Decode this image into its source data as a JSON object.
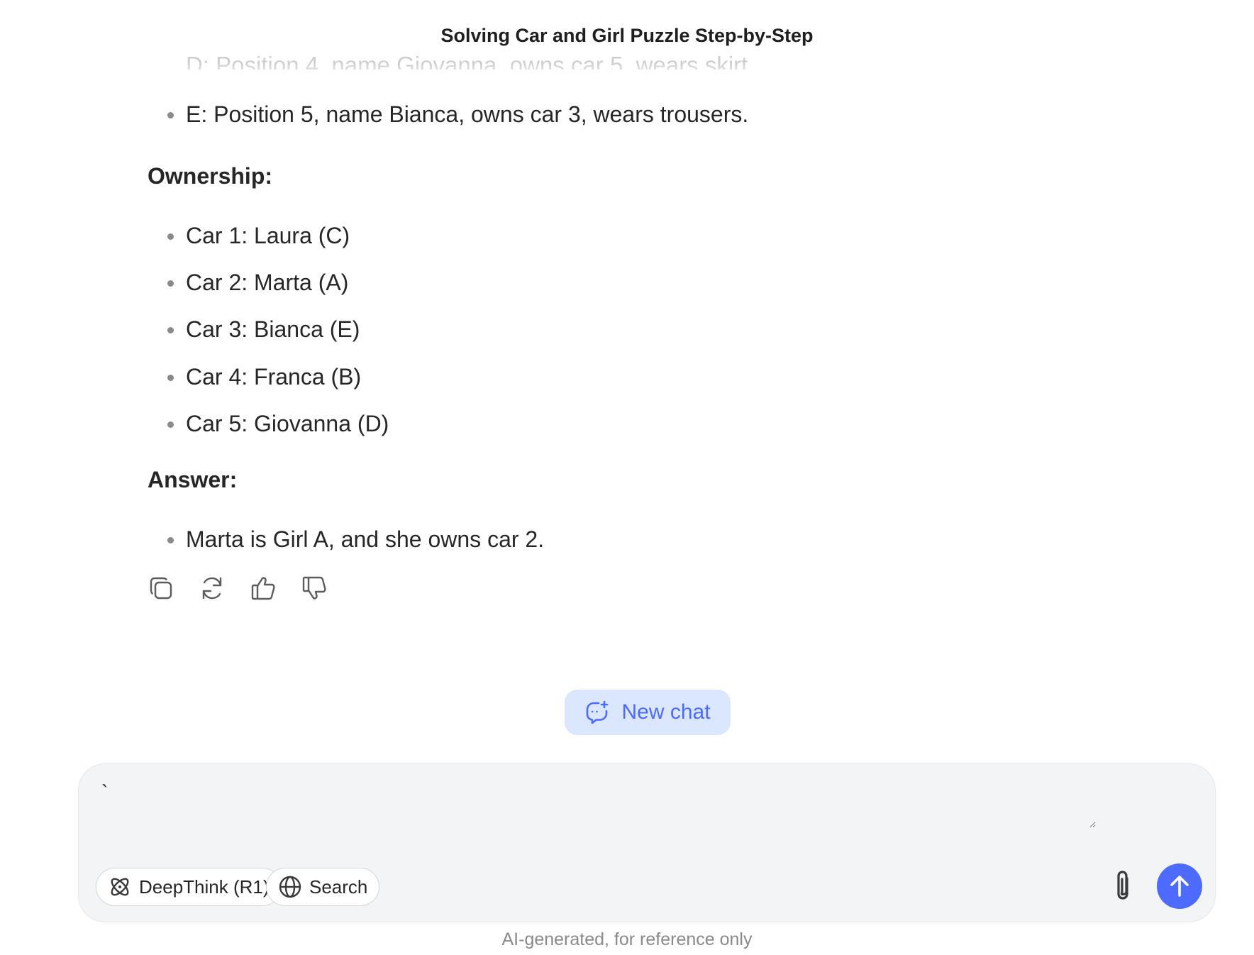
{
  "header": {
    "title": "Solving Car and Girl Puzzle Step-by-Step"
  },
  "message": {
    "faded_line": "D: Position 4, name Giovanna, owns car 5, wears skirt.",
    "intro_items": [
      "E: Position 5, name Bianca, owns car 3, wears trousers."
    ],
    "ownership_heading": "Ownership:",
    "ownership_items": [
      "Car 1: Laura (C)",
      "Car 2: Marta (A)",
      "Car 3: Bianca (E)",
      "Car 4: Franca (B)",
      "Car 5: Giovanna (D)"
    ],
    "answer_heading": "Answer:",
    "answer_items": [
      "Marta is Girl A, and she owns car 2."
    ]
  },
  "actions": {
    "icons": [
      "copy-icon",
      "regenerate-icon",
      "thumbs-up-icon",
      "thumbs-down-icon"
    ]
  },
  "new_chat": {
    "label": "New chat",
    "icon": "new-chat-icon"
  },
  "composer": {
    "value": "`",
    "deepthink_label": "DeepThink (R1)",
    "search_label": "Search",
    "accent": "#4d6bfe"
  },
  "footer": {
    "disclaimer": "AI-generated, for reference only"
  }
}
